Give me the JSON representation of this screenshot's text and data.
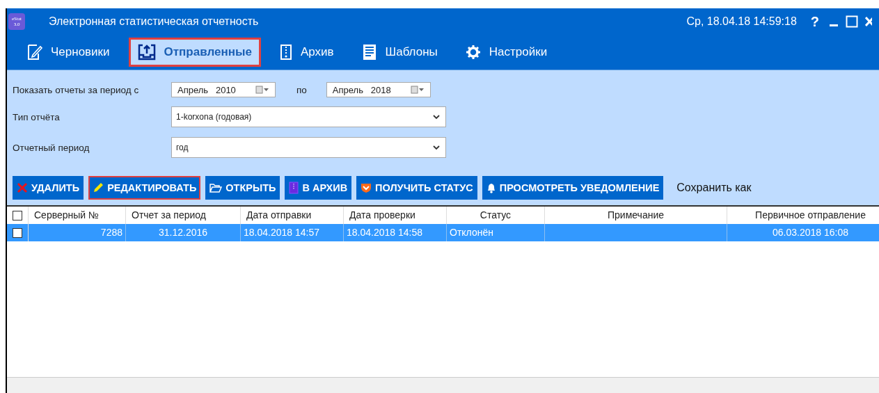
{
  "window": {
    "logo_text": "eStat 3.0",
    "title": "Электронная статистическая отчетность",
    "datetime": "Ср, 18.04.18 14:59:18",
    "help_glyph": "?"
  },
  "tabs": [
    {
      "label": "Черновики",
      "selected": false
    },
    {
      "label": "Отправленные",
      "selected": true
    },
    {
      "label": "Архив",
      "selected": false
    },
    {
      "label": "Шаблоны",
      "selected": false
    },
    {
      "label": "Настройки",
      "selected": false
    }
  ],
  "filters": {
    "period_label": "Показать отчеты за период с",
    "from": {
      "month": "Апрель",
      "year": "2010"
    },
    "to_label": "по",
    "to": {
      "month": "Апрель",
      "year": "2018"
    },
    "type_label": "Тип отчёта",
    "type_value": "1-korxona (годовая)",
    "period_kind_label": "Отчетный период",
    "period_kind_value": "год"
  },
  "toolbar": [
    {
      "label": "УДАЛИТЬ",
      "highlighted": false
    },
    {
      "label": "РЕДАКТИРОВАТЬ",
      "highlighted": true
    },
    {
      "label": "ОТКРЫТЬ",
      "highlighted": false
    },
    {
      "label": "В АРХИВ",
      "highlighted": false
    },
    {
      "label": "ПОЛУЧИТЬ СТАТУС",
      "highlighted": false
    },
    {
      "label": "ПРОСМОТРЕТЬ УВЕДОМЛЕНИЕ",
      "highlighted": false
    }
  ],
  "save_as_label": "Сохранить как",
  "table": {
    "header_checked": false,
    "columns": [
      "Серверный №",
      "Отчет за период",
      "Дата отправки",
      "Дата проверки",
      "Статус",
      "Примечание",
      "Первичное отправление"
    ],
    "rows": [
      {
        "checked": false,
        "selected": true,
        "cells": [
          "7288",
          "31.12.2016",
          "18.04.2018 14:57",
          "18.04.2018 14:58",
          "Отклонён",
          "",
          "06.03.2018 16:08"
        ]
      }
    ]
  }
}
